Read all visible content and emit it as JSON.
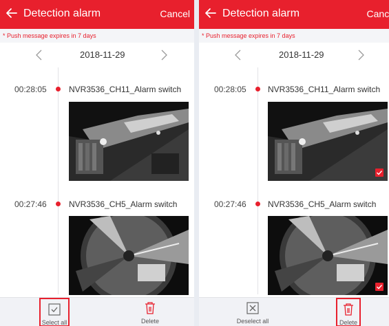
{
  "colors": {
    "accent": "#e8202d",
    "header_text": "#ffffff",
    "notice_bg": "#f4f5f8",
    "bottom_bar_bg": "#f1f2f6"
  },
  "icons": {
    "back": "back-arrow-icon",
    "prev": "chevron-left-icon",
    "next": "chevron-right-icon",
    "select_all": "checkbox-checked-icon",
    "deselect_all": "checkbox-x-icon",
    "delete": "trash-icon",
    "selected": "checkmark-icon"
  },
  "left": {
    "header": {
      "title": "Detection alarm",
      "cancel": "Cancel"
    },
    "notice": "* Push message expires in 7 days",
    "date": "2018-11-29",
    "events": [
      {
        "time": "00:28:05",
        "title": "NVR3536_CH11_Alarm switch",
        "selected": false
      },
      {
        "time": "00:27:46",
        "title": "NVR3536_CH5_Alarm switch",
        "selected": false
      }
    ],
    "bottom": {
      "action_left": "Select all",
      "action_right": "Delete"
    }
  },
  "right": {
    "header": {
      "title": "Detection alarm",
      "cancel": "Cance"
    },
    "notice": "* Push message expires in 7 days",
    "date": "2018-11-29",
    "events": [
      {
        "time": "00:28:05",
        "title": "NVR3536_CH11_Alarm switch",
        "selected": true
      },
      {
        "time": "00:27:46",
        "title": "NVR3536_CH5_Alarm switch",
        "selected": true
      }
    ],
    "bottom": {
      "action_left": "Deselect all",
      "action_right": "Delete"
    }
  }
}
